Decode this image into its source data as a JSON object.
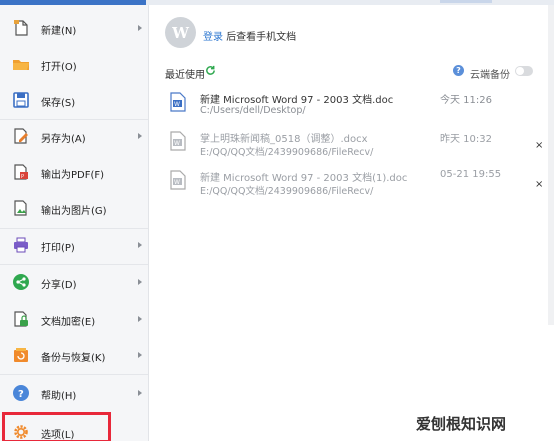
{
  "menu": [
    {
      "label": "新建(N)",
      "icon": "new-file-icon",
      "has_arrow": true
    },
    {
      "label": "打开(O)",
      "icon": "open-folder-icon",
      "has_arrow": false
    },
    {
      "label": "保存(S)",
      "icon": "save-icon",
      "has_arrow": false
    },
    {
      "label": "另存为(A)",
      "icon": "save-as-icon",
      "has_arrow": true
    },
    {
      "label": "输出为PDF(F)",
      "icon": "pdf-export-icon",
      "has_arrow": false
    },
    {
      "label": "输出为图片(G)",
      "icon": "image-export-icon",
      "has_arrow": false
    },
    {
      "label": "打印(P)",
      "icon": "print-icon",
      "has_arrow": true
    },
    {
      "label": "分享(D)",
      "icon": "share-icon",
      "has_arrow": true
    },
    {
      "label": "文档加密(E)",
      "icon": "encrypt-icon",
      "has_arrow": true
    },
    {
      "label": "备份与恢复(K)",
      "icon": "backup-icon",
      "has_arrow": true
    },
    {
      "label": "帮助(H)",
      "icon": "help-icon",
      "has_arrow": true
    },
    {
      "label": "选项(L)",
      "icon": "options-gear-icon",
      "has_arrow": false
    }
  ],
  "account": {
    "login_link": "登录",
    "login_suffix": "后查看手机文档"
  },
  "recent": {
    "label": "最近使用",
    "cloud_backup_label": "云端备份",
    "cloud_backup_on": false,
    "files": [
      {
        "name": "新建 Microsoft Word 97 - 2003 文档.doc",
        "path": "C:/Users/dell/Desktop/",
        "time": "今天 11:26",
        "dimmed": false,
        "close": ""
      },
      {
        "name": "掌上明珠新闻稿_0518（调整）.docx",
        "path": "E:/QQ/QQ文档/2439909686/FileRecv/",
        "time": "昨天 10:32",
        "dimmed": true,
        "close": "×"
      },
      {
        "name": "新建 Microsoft Word 97 - 2003 文档(1).doc",
        "path": "E:/QQ/QQ文档/2439909686/FileRecv/",
        "time": "05-21 19:55",
        "dimmed": true,
        "close": "×"
      }
    ]
  },
  "watermark": "爱刨根知识网",
  "colors": {
    "accent": "#3b73c6",
    "link": "#2d77d0",
    "highlight_border": "#e8283a"
  }
}
